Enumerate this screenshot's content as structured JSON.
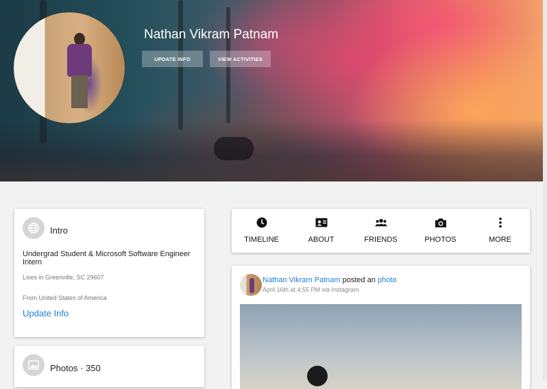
{
  "profile": {
    "name": "Nathan Vikram Patnam",
    "buttons": {
      "update_info": "UPDATE INFO",
      "view_activities": "VIEW ACTIVITIES"
    }
  },
  "intro": {
    "title": "Intro",
    "description": "Undergrad Student & Microsoft Software Engineer Intern",
    "lives_in": "Lives in Greenville, SC 29607",
    "from": "From United States of America",
    "update_link": "Update Info"
  },
  "photos": {
    "title": "Photos · 350"
  },
  "tabs": [
    {
      "label": "TIMELINE",
      "icon": "clock-icon"
    },
    {
      "label": "ABOUT",
      "icon": "id-card-icon"
    },
    {
      "label": "FRIENDS",
      "icon": "people-icon"
    },
    {
      "label": "PHOTOS",
      "icon": "camera-icon"
    },
    {
      "label": "MORE",
      "icon": "more-vertical-icon"
    }
  ],
  "post": {
    "author": "Nathan Vikram Patnam",
    "action": " posted an ",
    "object": "photo",
    "meta": "April 16th at 4:55 PM via Instagram"
  },
  "colors": {
    "link": "#1e7fd6",
    "card_bg": "#ffffff",
    "page_bg": "#f2f2f2"
  }
}
